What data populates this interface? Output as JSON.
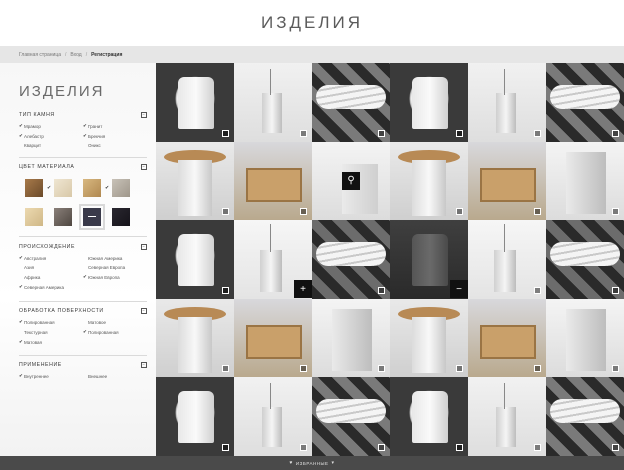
{
  "header": {
    "title": "ИЗДЕЛИЯ"
  },
  "breadcrumb": {
    "items": [
      "Главная страница",
      "Вход"
    ],
    "current": "Регистрация"
  },
  "sidebar": {
    "title": "ИЗДЕЛИЯ",
    "stone_type": {
      "heading": "ТИП КАМНЯ",
      "toggle": "−",
      "options": [
        {
          "label": "Мрамор",
          "checked": true
        },
        {
          "label": "Гранит",
          "checked": true
        },
        {
          "label": "Алебастр",
          "checked": true
        },
        {
          "label": "Брекчия",
          "checked": true
        },
        {
          "label": "Кварцит",
          "checked": false
        },
        {
          "label": "Оникс",
          "checked": false
        }
      ]
    },
    "material_color": {
      "heading": "ЦВЕТ МАТЕРИАЛА",
      "toggle": "−",
      "swatches": [
        {
          "color": "#a87a4a",
          "checked": false,
          "selected": false
        },
        {
          "color": "#e8dcc4",
          "checked": true,
          "selected": false
        },
        {
          "color": "#c9a870",
          "checked": false,
          "selected": false
        },
        {
          "color": "#b8b1a6",
          "checked": true,
          "selected": false
        },
        {
          "color": "#e2cfa4",
          "checked": false,
          "selected": false
        },
        {
          "color": "#6e6660",
          "checked": false,
          "selected": false
        },
        {
          "color": "#3a3a4a",
          "checked": false,
          "selected": true
        },
        {
          "color": "#1f1d24",
          "checked": false,
          "selected": false
        }
      ]
    },
    "origin": {
      "heading": "ПРОИСХОЖДЕНИЕ",
      "toggle": "−",
      "options": [
        {
          "label": "Австралия",
          "checked": true
        },
        {
          "label": "Южная Америка",
          "checked": false
        },
        {
          "label": "Азия",
          "checked": false
        },
        {
          "label": "Северная Европа",
          "checked": false
        },
        {
          "label": "Африка",
          "checked": false
        },
        {
          "label": "Южная Европа",
          "checked": true
        },
        {
          "label": "Северная Америка",
          "checked": true
        }
      ]
    },
    "surface_treatment": {
      "heading": "ОБРАБОТКА ПОВЕРХНОСТИ",
      "toggle": "−",
      "options": [
        {
          "label": "Полированная",
          "checked": true
        },
        {
          "label": "Матовое",
          "checked": false
        },
        {
          "label": "Текстурная",
          "checked": false
        },
        {
          "label": "Полированная",
          "checked": true
        },
        {
          "label": "Матовая",
          "checked": true
        }
      ]
    },
    "application": {
      "heading": "ПРИМЕНЕНИЕ",
      "toggle": "−",
      "options": [
        {
          "label": "Внутреннее",
          "checked": true
        },
        {
          "label": "Внешнее",
          "checked": false
        }
      ]
    }
  },
  "grid": {
    "overlays": {
      "search": "⚲",
      "plus": "+",
      "minus": "−"
    }
  },
  "bottom_bar": {
    "label": "ИЗБРАННЫЕ",
    "left_icon": "heart-icon",
    "right_icon": "caret-down-icon"
  }
}
